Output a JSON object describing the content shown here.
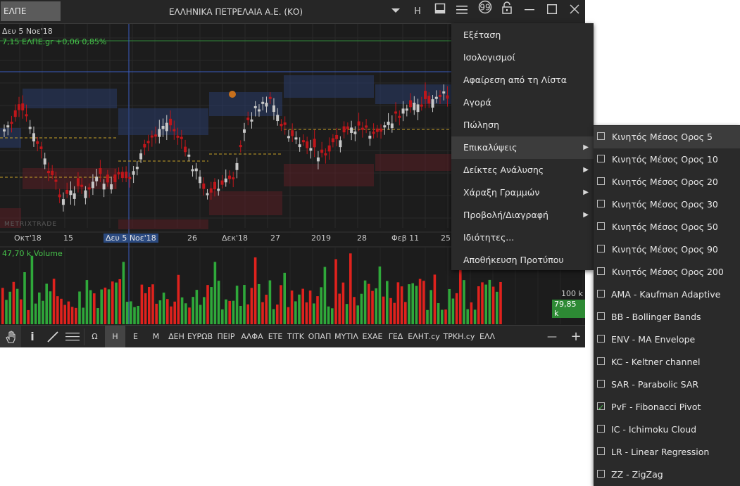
{
  "window": {
    "symbol": "ΕΛΠΕ",
    "title": "ΕΛΛΗΝΙΚΑ ΠΕΤΡΕΛΑΙΑ Α.Ε. (ΚΟ)",
    "h_label": "H"
  },
  "chart": {
    "date_label": "Δευ 5 Νοε'18",
    "price_line": "7,15 ΕΛΠΕ.gr +0,06 0,85%",
    "volume_line": "47,70 k Volume",
    "x_labels": [
      "Οκτ'18",
      "15",
      "Δευ 5 Νοε'18",
      "26",
      "Δεκ'18",
      "27",
      "2019",
      "28",
      "Φεβ 11",
      "25"
    ],
    "volume_axis": "100 k",
    "volume_value": "79,85 k",
    "watermark": "METRIXTRADE"
  },
  "toolbar": {
    "items": [
      "Ω",
      "Η",
      "Ε",
      "Μ",
      "ΔΕΗ",
      "ΕΥΡΩΒ",
      "ΠΕΙΡ",
      "ΑΛΦΑ",
      "ΕΤΕ",
      "ΤΙΤΚ",
      "ΟΠΑΠ",
      "ΜΥΤΙΛ",
      "ΕΧΑΕ",
      "ΓΕΔ",
      "ΕΛΗΤ.cy",
      "ΤΡΚΗ.cy",
      "ΕΛΛ"
    ],
    "active": "Η",
    "zoom_out": "—",
    "zoom_in": "+"
  },
  "context_menu": {
    "items": [
      {
        "label": "Εξέταση",
        "submenu": false
      },
      {
        "label": "Ισολογισμοί",
        "submenu": false
      },
      {
        "label": "Αφαίρεση από τη Λίστα",
        "submenu": false
      },
      {
        "label": "Αγορά",
        "submenu": false
      },
      {
        "label": "Πώληση",
        "submenu": false
      },
      {
        "label": "Επικαλύψεις",
        "submenu": true,
        "highlighted": true
      },
      {
        "label": "Δείκτες Ανάλυσης",
        "submenu": true
      },
      {
        "label": "Χάραξη Γραμμών",
        "submenu": true
      },
      {
        "label": "Προβολή/Διαγραφή",
        "submenu": true
      },
      {
        "label": "Ιδιότητες...",
        "submenu": false
      },
      {
        "label": "Αποθήκευση Προτύπου",
        "submenu": false
      }
    ]
  },
  "submenu": {
    "items": [
      {
        "label": "Κινητός Μέσος Ορος 5",
        "checked": false,
        "highlighted": true
      },
      {
        "label": "Κινητός Μέσος Ορος 10",
        "checked": false
      },
      {
        "label": "Κινητός Μέσος Ορος 20",
        "checked": false
      },
      {
        "label": "Κινητός Μέσος Ορος 30",
        "checked": false
      },
      {
        "label": "Κινητός Μέσος Ορος 50",
        "checked": false
      },
      {
        "label": "Κινητός Μέσος Ορος 90",
        "checked": false
      },
      {
        "label": "Κινητός Μέσος Ορος 200",
        "checked": false
      },
      {
        "label": "AMA - Kaufman Adaptive",
        "checked": false
      },
      {
        "label": "BB - Bollinger Bands",
        "checked": false
      },
      {
        "label": "ENV - MA Envelope",
        "checked": false
      },
      {
        "label": "KC - Keltner channel",
        "checked": false
      },
      {
        "label": "SAR - Parabolic SAR",
        "checked": false
      },
      {
        "label": "PvF - Fibonacci Pivot",
        "checked": true
      },
      {
        "label": "IC - Ichimoku Cloud",
        "checked": false
      },
      {
        "label": "LR - Linear Regression",
        "checked": false
      },
      {
        "label": "ZZ - ZigZag",
        "checked": false
      }
    ]
  },
  "colors": {
    "up": "#c8c8c8",
    "down": "#c0161b",
    "volume_up": "#2fa83a",
    "volume_down": "#e0221d",
    "highlight_line": "#3a5cc0"
  }
}
